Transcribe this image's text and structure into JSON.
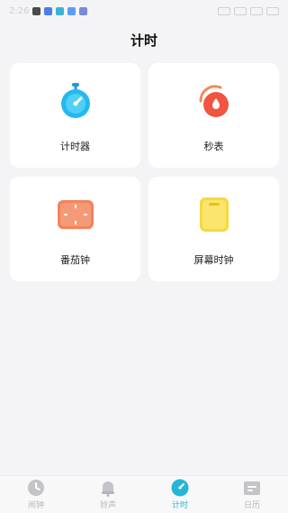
{
  "status_bar": {
    "time": "2:26",
    "colors": {
      "app1": "#4a4a4a",
      "app2": "#4f7de8",
      "app3": "#38b4d8",
      "app4": "#5a9ef0",
      "app5": "#7c8bd6"
    }
  },
  "page": {
    "title": "计时"
  },
  "cards": [
    {
      "label": "计时器",
      "icon": "stopwatch-icon",
      "color": "#25b8f0"
    },
    {
      "label": "秒表",
      "icon": "timer-dial-icon",
      "color": "#f0553f"
    },
    {
      "label": "番茄钟",
      "icon": "tomato-clock-icon",
      "color": "#f2835c"
    },
    {
      "label": "屏幕时钟",
      "icon": "screen-clock-icon",
      "color": "#f6d93d"
    }
  ],
  "tabs": [
    {
      "label": "闹钟",
      "icon": "clock-icon",
      "active": false
    },
    {
      "label": "铃声",
      "icon": "bell-icon",
      "active": false
    },
    {
      "label": "计时",
      "icon": "timer-icon",
      "active": true
    },
    {
      "label": "日历",
      "icon": "calendar-icon",
      "active": false
    }
  ],
  "colors": {
    "accent": "#23b6d6",
    "inactive": "#b7b7bd",
    "background": "#f4f4f6"
  }
}
